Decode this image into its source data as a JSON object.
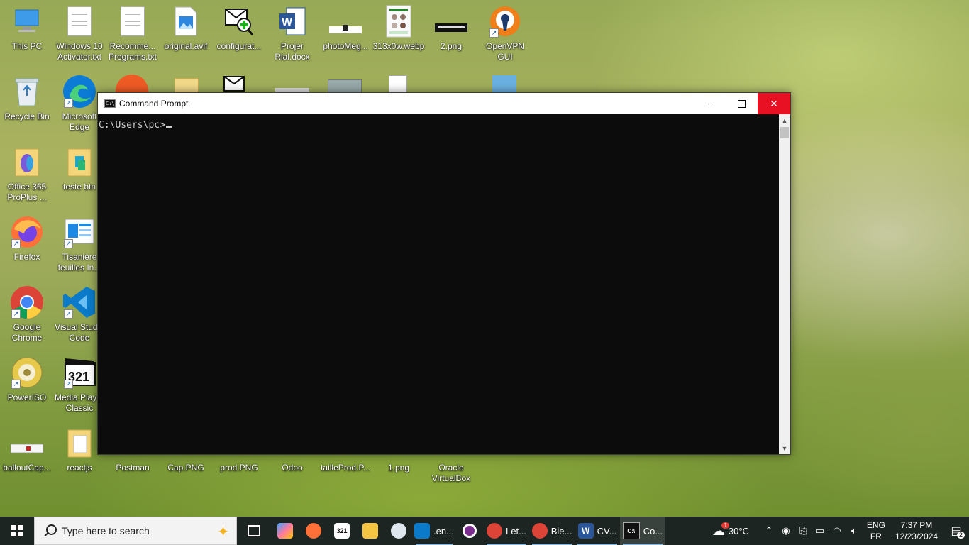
{
  "desktop": {
    "icons": [
      {
        "label": "This PC",
        "icon": "computer-icon"
      },
      {
        "label": "Windows 10\nActivator.txt",
        "icon": "text-file-icon"
      },
      {
        "label": "Recomme...\nPrograms.txt",
        "icon": "text-file-icon"
      },
      {
        "label": "original.avif",
        "icon": "image-file-icon"
      },
      {
        "label": "configurat...",
        "icon": "config-file-icon"
      },
      {
        "label": "Projer\nRial.docx",
        "icon": "word-document-icon"
      },
      {
        "label": "photoMeg...",
        "icon": "image-thumbnail-icon"
      },
      {
        "label": "313x0w.webp",
        "icon": "image-thumbnail-icon"
      },
      {
        "label": "2.png",
        "icon": "image-thumbnail-icon"
      },
      {
        "label": "OpenVPN\nGUI",
        "icon": "openvpn-icon"
      },
      {
        "label": "Recycle Bin",
        "icon": "recycle-bin-icon"
      },
      {
        "label": "Microsoft\nEdge",
        "icon": "edge-icon"
      },
      {
        "label": "Office 365\nProPlus ...",
        "icon": "folder-icon"
      },
      {
        "label": "teste btn",
        "icon": "folder-icon"
      },
      {
        "label": "Firefox",
        "icon": "firefox-icon"
      },
      {
        "label": "Tisanière\nfeuilles In...",
        "icon": "document-shortcut-icon"
      },
      {
        "label": "Google\nChrome",
        "icon": "chrome-icon"
      },
      {
        "label": "Visual Studio\nCode",
        "icon": "vscode-icon"
      },
      {
        "label": "PowerISO",
        "icon": "poweriso-icon"
      },
      {
        "label": "Media Player\nClassic",
        "icon": "media-player-icon"
      },
      {
        "label": "balloutCap...",
        "icon": "image-thumbnail-icon"
      },
      {
        "label": "reactjs",
        "icon": "folder-icon"
      },
      {
        "label": "Postman",
        "icon": "postman-icon"
      },
      {
        "label": "Cap.PNG",
        "icon": "image-thumbnail-icon"
      },
      {
        "label": "prod.PNG",
        "icon": "image-thumbnail-icon"
      },
      {
        "label": "Odoo",
        "icon": "odoo-icon"
      },
      {
        "label": "tailleProd.P...",
        "icon": "image-thumbnail-icon"
      },
      {
        "label": "1.png",
        "icon": "image-thumbnail-icon"
      },
      {
        "label": "Oracle\nVirtualBox",
        "icon": "virtualbox-icon"
      }
    ]
  },
  "window": {
    "title": "Command Prompt",
    "prompt": "C:\\Users\\pc>"
  },
  "taskbar": {
    "search_placeholder": "Type here to search",
    "items": [
      {
        "label": "",
        "icon": "task-view-icon"
      },
      {
        "label": "",
        "icon": "copilot-icon"
      },
      {
        "label": "",
        "icon": "firefox-icon"
      },
      {
        "label": "",
        "icon": "media-player-icon"
      },
      {
        "label": "",
        "icon": "file-explorer-icon"
      },
      {
        "label": "",
        "icon": "paint-icon"
      },
      {
        "label": ".en...",
        "icon": "vscode-icon"
      },
      {
        "label": "",
        "icon": "obs-icon"
      },
      {
        "label": "Let...",
        "icon": "chrome-icon"
      },
      {
        "label": "Bie...",
        "icon": "chrome-icon"
      },
      {
        "label": "CV...",
        "icon": "word-icon"
      },
      {
        "label": "Co...",
        "icon": "cmd-icon"
      }
    ],
    "weather": "30°C",
    "weather_badge": "1",
    "lang_top": "ENG",
    "lang_bottom": "FR",
    "time": "7:37 PM",
    "date": "12/23/2024",
    "notification_count": "2"
  },
  "colors": {
    "taskbar": "#1c2521",
    "close_button": "#e81123",
    "console_bg": "#0c0c0c",
    "console_text": "#cccccc"
  }
}
